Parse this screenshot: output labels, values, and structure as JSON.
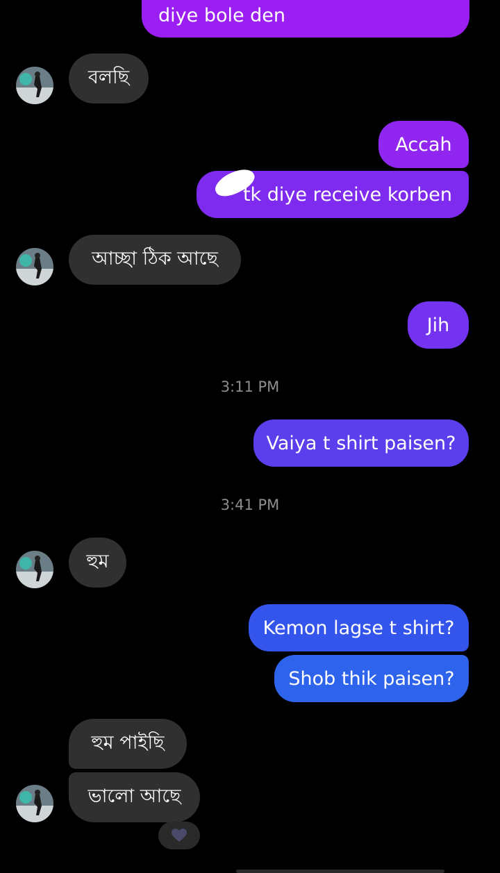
{
  "messages": [
    {
      "id": "m0",
      "dir": "out",
      "text": "diye bole den"
    },
    {
      "id": "m1",
      "dir": "in",
      "text": "বলছি"
    },
    {
      "id": "m2",
      "dir": "out",
      "text": "Accah"
    },
    {
      "id": "m3",
      "dir": "out",
      "text": "tk diye receive korben",
      "note": "amount redacted"
    },
    {
      "id": "m4",
      "dir": "in",
      "text": "আচ্ছা ঠিক আছে"
    },
    {
      "id": "m5",
      "dir": "out",
      "text": "Jih"
    },
    {
      "id": "t1",
      "type": "timestamp",
      "text": "3:11 PM"
    },
    {
      "id": "m6",
      "dir": "out",
      "text": "Vaiya t shirt paisen?"
    },
    {
      "id": "t2",
      "type": "timestamp",
      "text": "3:41 PM"
    },
    {
      "id": "m7",
      "dir": "in",
      "text": "হুম"
    },
    {
      "id": "m8",
      "dir": "out",
      "text": "Kemon lagse t shirt?"
    },
    {
      "id": "m9",
      "dir": "out",
      "text": "Shob thik paisen?"
    },
    {
      "id": "m10",
      "dir": "in",
      "text": "হুম পাইছি"
    },
    {
      "id": "m11",
      "dir": "in",
      "text": "ভালো আছে"
    }
  ],
  "reaction": {
    "icon": "heart-icon",
    "color": "#4a4a6a"
  },
  "colors": {
    "outgoing_purple": "#9B1EF2",
    "outgoing_violet": "#6B35EE",
    "outgoing_blue": "#2E63EB",
    "incoming": "#303030",
    "background": "#000000"
  }
}
